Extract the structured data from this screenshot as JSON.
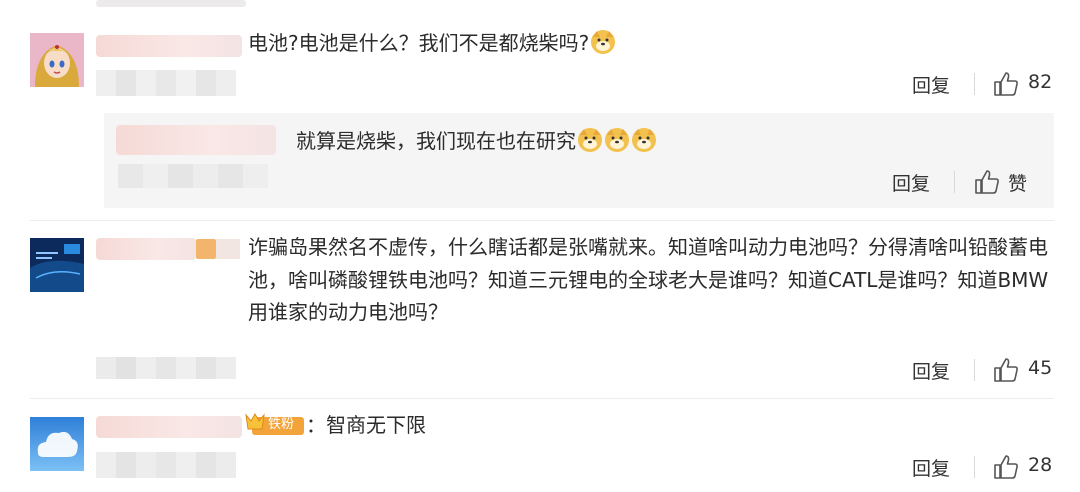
{
  "comments": [
    {
      "text": "电池?电池是什么？我们不是都烧柴吗?",
      "emoji_count": 1,
      "reply_label": "回复",
      "like_count": "82"
    },
    {
      "text": "诈骗岛果然名不虚传，什么瞎话都是张嘴就来。知道啥叫动力电池吗？分得清啥叫铅酸蓄电池，啥叫磷酸锂铁电池吗？知道三元锂电的全球老大是谁吗？知道CATL是谁吗？知道BMW用谁家的动力电池吗？",
      "reply_label": "回复",
      "like_count": "45"
    },
    {
      "badge_text": "铁粉",
      "text": "：智商无下限",
      "reply_label": "回复",
      "like_count": "28"
    }
  ],
  "reply": {
    "text": "就算是烧柴，我们现在也在研究",
    "emoji_count": 3,
    "reply_label": "回复",
    "like_label": "赞"
  },
  "icons": {
    "like": "thumbs-up-icon",
    "emoji": "doge-emoji-icon",
    "badge": "crown-badge-icon"
  }
}
